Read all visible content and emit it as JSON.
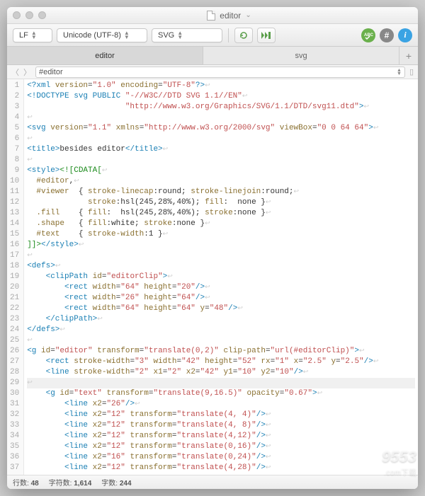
{
  "title": "editor",
  "toolbar": {
    "line_ending": "LF",
    "encoding": "Unicode (UTF-8)",
    "syntax": "SVG"
  },
  "tabs": [
    {
      "label": "editor",
      "active": true
    },
    {
      "label": "svg",
      "active": false
    }
  ],
  "breadcrumb": {
    "nav_prev": "〈",
    "nav_next": "〉",
    "path": "#editor"
  },
  "code": {
    "lines": [
      {
        "n": 1,
        "html": "<span class='c-tag'>&lt;?xml</span> <span class='c-attr'>version</span>=<span class='c-str'>\"1.0\"</span> <span class='c-attr'>encoding</span>=<span class='c-str'>\"UTF-8\"</span><span class='c-tag'>?&gt;</span>"
      },
      {
        "n": 2,
        "html": "<span class='c-tag'>&lt;!DOCTYPE svg PUBLIC</span> <span class='c-str'>\"-//W3C//DTD SVG 1.1//EN\"</span>"
      },
      {
        "n": 3,
        "html": "                     <span class='c-str'>\"http://www.w3.org/Graphics/SVG/1.1/DTD/svg11.dtd\"</span><span class='c-tag'>&gt;</span>"
      },
      {
        "n": 4,
        "html": ""
      },
      {
        "n": 5,
        "html": "<span class='c-tag'>&lt;svg</span> <span class='c-attr'>version</span>=<span class='c-str'>\"1.1\"</span> <span class='c-attr'>xmlns</span>=<span class='c-str'>\"http://www.w3.org/2000/svg\"</span> <span class='c-attr'>viewBox</span>=<span class='c-str'>\"0 0 64 64\"</span><span class='c-tag'>&gt;</span>"
      },
      {
        "n": 6,
        "html": ""
      },
      {
        "n": 7,
        "html": "<span class='c-tag'>&lt;title&gt;</span>besides editor<span class='c-tag'>&lt;/title&gt;</span>"
      },
      {
        "n": 8,
        "html": ""
      },
      {
        "n": 9,
        "html": "<span class='c-tag'>&lt;style&gt;</span><span class='c-kw'>&lt;![CDATA[</span>"
      },
      {
        "n": 10,
        "html": "  <span class='c-attr'>#editor</span>,"
      },
      {
        "n": 11,
        "html": "  <span class='c-attr'>#viewer</span>  { <span class='c-attr'>stroke-linecap</span>:round; <span class='c-attr'>stroke-linejoin</span>:round;"
      },
      {
        "n": 12,
        "html": "             <span class='c-attr'>stroke</span>:hsl(245,28%,40%); <span class='c-attr'>fill</span>:  none }"
      },
      {
        "n": 13,
        "html": "  <span class='c-attr'>.fill</span>    { <span class='c-attr'>fill</span>:  hsl(245,28%,40%); <span class='c-attr'>stroke</span>:none }"
      },
      {
        "n": 14,
        "html": "  <span class='c-attr'>.shape</span>   { <span class='c-attr'>fill</span>:white; <span class='c-attr'>stroke</span>:none }"
      },
      {
        "n": 15,
        "html": "  <span class='c-attr'>#text</span>    { <span class='c-attr'>stroke-width</span>:1 }"
      },
      {
        "n": 16,
        "html": "<span class='c-kw'>]]&gt;</span><span class='c-tag'>&lt;/style&gt;</span>"
      },
      {
        "n": 17,
        "html": ""
      },
      {
        "n": 18,
        "html": "<span class='c-tag'>&lt;defs&gt;</span>"
      },
      {
        "n": 19,
        "html": "    <span class='c-tag'>&lt;clipPath</span> <span class='c-attr'>id</span>=<span class='c-str'>\"editorClip\"</span><span class='c-tag'>&gt;</span>"
      },
      {
        "n": 20,
        "html": "        <span class='c-tag'>&lt;rect</span> <span class='c-attr'>width</span>=<span class='c-str'>\"64\"</span> <span class='c-attr'>height</span>=<span class='c-str'>\"20\"</span><span class='c-tag'>/&gt;</span>"
      },
      {
        "n": 21,
        "html": "        <span class='c-tag'>&lt;rect</span> <span class='c-attr'>width</span>=<span class='c-str'>\"26\"</span> <span class='c-attr'>height</span>=<span class='c-str'>\"64\"</span><span class='c-tag'>/&gt;</span>"
      },
      {
        "n": 22,
        "html": "        <span class='c-tag'>&lt;rect</span> <span class='c-attr'>width</span>=<span class='c-str'>\"64\"</span> <span class='c-attr'>height</span>=<span class='c-str'>\"64\"</span> <span class='c-attr'>y</span>=<span class='c-str'>\"48\"</span><span class='c-tag'>/&gt;</span>"
      },
      {
        "n": 23,
        "html": "    <span class='c-tag'>&lt;/clipPath&gt;</span>"
      },
      {
        "n": 24,
        "html": "<span class='c-tag'>&lt;/defs&gt;</span>"
      },
      {
        "n": 25,
        "html": ""
      },
      {
        "n": 26,
        "html": "<span class='c-tag'>&lt;g</span> <span class='c-attr'>id</span>=<span class='c-str'>\"editor\"</span> <span class='c-attr'>transform</span>=<span class='c-str'>\"translate(0,2)\"</span> <span class='c-attr'>clip-path</span>=<span class='c-str'>\"url(#editorClip)\"</span><span class='c-tag'>&gt;</span>"
      },
      {
        "n": 27,
        "html": "    <span class='c-tag'>&lt;rect</span> <span class='c-attr'>stroke-width</span>=<span class='c-str'>\"3\"</span> <span class='c-attr'>width</span>=<span class='c-str'>\"42\"</span> <span class='c-attr'>height</span>=<span class='c-str'>\"52\"</span> <span class='c-attr'>rx</span>=<span class='c-str'>\"1\"</span> <span class='c-attr'>x</span>=<span class='c-str'>\"2.5\"</span> <span class='c-attr'>y</span>=<span class='c-str'>\"2.5\"</span><span class='c-tag'>/&gt;</span>"
      },
      {
        "n": 28,
        "html": "    <span class='c-tag'>&lt;line</span> <span class='c-attr'>stroke-width</span>=<span class='c-str'>\"2\"</span> <span class='c-attr'>x1</span>=<span class='c-str'>\"2\"</span> <span class='c-attr'>x2</span>=<span class='c-str'>\"42\"</span> <span class='c-attr'>y1</span>=<span class='c-str'>\"10\"</span> <span class='c-attr'>y2</span>=<span class='c-str'>\"10\"</span><span class='c-tag'>/&gt;</span>"
      },
      {
        "n": 29,
        "html": "",
        "highlight": true
      },
      {
        "n": 30,
        "html": "    <span class='c-tag'>&lt;g</span> <span class='c-attr'>id</span>=<span class='c-str'>\"text\"</span> <span class='c-attr'>transform</span>=<span class='c-str'>\"translate(9,16.5)\"</span> <span class='c-attr'>opacity</span>=<span class='c-str'>\"0.67\"</span><span class='c-tag'>&gt;</span>"
      },
      {
        "n": 31,
        "html": "        <span class='c-tag'>&lt;line</span> <span class='c-attr'>x2</span>=<span class='c-str'>\"26\"</span><span class='c-tag'>/&gt;</span>"
      },
      {
        "n": 32,
        "html": "        <span class='c-tag'>&lt;line</span> <span class='c-attr'>x2</span>=<span class='c-str'>\"12\"</span> <span class='c-attr'>transform</span>=<span class='c-str'>\"translate(4, 4)\"</span><span class='c-tag'>/&gt;</span>"
      },
      {
        "n": 33,
        "html": "        <span class='c-tag'>&lt;line</span> <span class='c-attr'>x2</span>=<span class='c-str'>\"12\"</span> <span class='c-attr'>transform</span>=<span class='c-str'>\"translate(4, 8)\"</span><span class='c-tag'>/&gt;</span>"
      },
      {
        "n": 34,
        "html": "        <span class='c-tag'>&lt;line</span> <span class='c-attr'>x2</span>=<span class='c-str'>\"12\"</span> <span class='c-attr'>transform</span>=<span class='c-str'>\"translate(4,12)\"</span><span class='c-tag'>/&gt;</span>"
      },
      {
        "n": 35,
        "html": "        <span class='c-tag'>&lt;line</span> <span class='c-attr'>x2</span>=<span class='c-str'>\"12\"</span> <span class='c-attr'>transform</span>=<span class='c-str'>\"translate(0,16)\"</span><span class='c-tag'>/&gt;</span>"
      },
      {
        "n": 36,
        "html": "        <span class='c-tag'>&lt;line</span> <span class='c-attr'>x2</span>=<span class='c-str'>\"16\"</span> <span class='c-attr'>transform</span>=<span class='c-str'>\"translate(0,24)\"</span><span class='c-tag'>/&gt;</span>"
      },
      {
        "n": 37,
        "html": "        <span class='c-tag'>&lt;line</span> <span class='c-attr'>x2</span>=<span class='c-str'>\"12\"</span> <span class='c-attr'>transform</span>=<span class='c-str'>\"translate(4,28)\"</span><span class='c-tag'>/&gt;</span>"
      }
    ]
  },
  "status": {
    "lines_label": "行数:",
    "lines_value": "48",
    "chars_label": "字符数:",
    "chars_value": "1,614",
    "words_label": "字数:",
    "words_value": "244"
  },
  "watermark": "9553",
  "watermark_sub": ".com下载"
}
